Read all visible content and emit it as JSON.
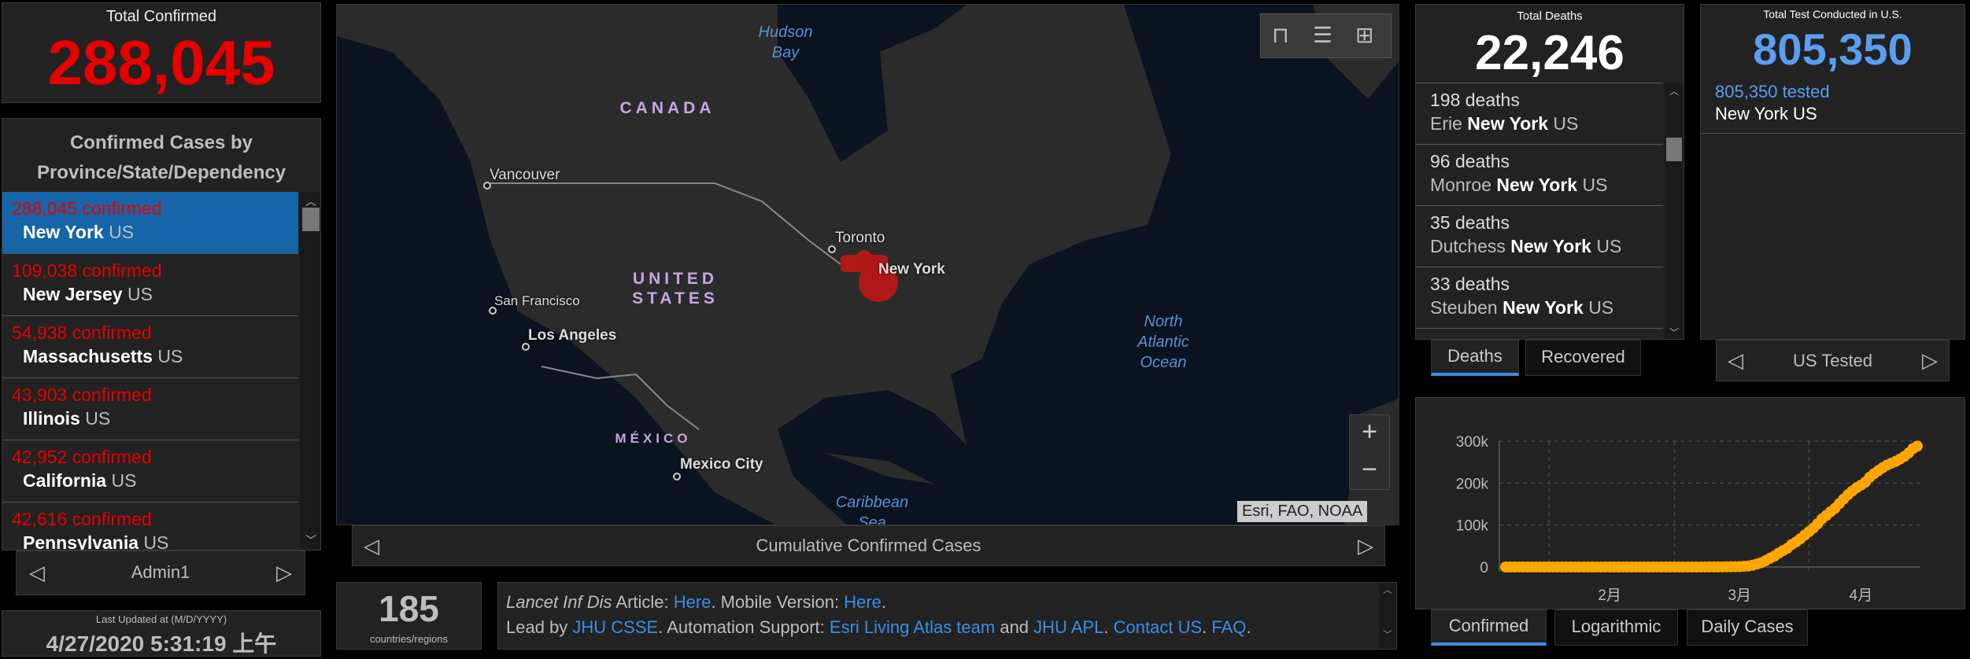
{
  "total_confirmed": {
    "title": "Total Confirmed",
    "value": "288,045"
  },
  "confirmed_list": {
    "title_line1": "Confirmed Cases by",
    "title_line2": "Province/State/Dependency",
    "items": [
      {
        "count": "288,045 confirmed",
        "region": "New York",
        "country": "US",
        "selected": true
      },
      {
        "count": "109,038 confirmed",
        "region": "New Jersey",
        "country": "US"
      },
      {
        "count": "54,938 confirmed",
        "region": "Massachusetts",
        "country": "US"
      },
      {
        "count": "43,903 confirmed",
        "region": "Illinois",
        "country": "US"
      },
      {
        "count": "42,952 confirmed",
        "region": "California",
        "country": "US"
      },
      {
        "count": "42,616 confirmed",
        "region": "Pennsylvania",
        "country": "US"
      }
    ],
    "footer_label": "Admin1"
  },
  "last_updated": {
    "label": "Last Updated at (M/D/YYYY)",
    "value": "4/27/2020 5:31:19 上午"
  },
  "map": {
    "labels": {
      "hudson1": "Hudson",
      "hudson2": "Bay",
      "canada": "CANADA",
      "vancouver": "Vancouver",
      "toronto": "Toronto",
      "new_york": "New York",
      "us1": "UNITED",
      "us2": "STATES",
      "san_francisco": "San Francisco",
      "los_angeles": "Los Angeles",
      "atl1": "North",
      "atl2": "Atlantic",
      "atl3": "Ocean",
      "mexico": "MÉXICO",
      "mexico_city": "Mexico City",
      "carib1": "Caribbean",
      "carib2": "Sea"
    },
    "attribution": "Esri, FAO, NOAA",
    "caption": "Cumulative Confirmed Cases",
    "zoom_in": "+",
    "zoom_out": "−",
    "toolbar_icons": [
      "bookmark-icon",
      "legend-list-icon",
      "basemap-gallery-icon"
    ],
    "colors": {
      "water": "#0b1320",
      "land": "#2b2b2b",
      "cases": "#c81414"
    }
  },
  "countries": {
    "value": "185",
    "label": "countries/regions"
  },
  "info": {
    "line1": [
      {
        "t": "Lancet Inf Dis",
        "style": "italic"
      },
      {
        "t": " Article: "
      },
      {
        "t": "Here",
        "link": true
      },
      {
        "t": ". Mobile Version: "
      },
      {
        "t": "Here",
        "link": true
      },
      {
        "t": "."
      }
    ],
    "line2": [
      {
        "t": "Lead by "
      },
      {
        "t": "JHU CSSE",
        "link": true
      },
      {
        "t": ". Automation Support: "
      },
      {
        "t": "Esri Living Atlas team",
        "link": true
      },
      {
        "t": " and "
      },
      {
        "t": "JHU APL",
        "link": true
      },
      {
        "t": ". "
      },
      {
        "t": "Contact US",
        "link": true
      },
      {
        "t": ". "
      },
      {
        "t": "FAQ",
        "link": true
      },
      {
        "t": "."
      }
    ]
  },
  "deaths": {
    "title": "Total Deaths",
    "value": "22,246",
    "items": [
      {
        "count": "198 deaths",
        "county": "Erie",
        "state": "New York",
        "country": "US"
      },
      {
        "count": "96 deaths",
        "county": "Monroe",
        "state": "New York",
        "country": "US"
      },
      {
        "count": "35 deaths",
        "county": "Dutchess",
        "state": "New York",
        "country": "US"
      },
      {
        "count": "33 deaths",
        "county": "Steuben",
        "state": "New York",
        "country": "US"
      }
    ],
    "tabs": [
      "Deaths",
      "Recovered"
    ]
  },
  "tests": {
    "title": "Total Test Conducted in U.S.",
    "value": "805,350",
    "item_count": "805,350 tested",
    "item_region": "New York US",
    "footer_label": "US Tested"
  },
  "chart_tabs": [
    "Confirmed",
    "Logarithmic",
    "Daily Cases"
  ],
  "chart_data": {
    "type": "scatter",
    "color": "#ffa500",
    "yticks": [
      "0",
      "100k",
      "200k",
      "300k"
    ],
    "ylim": [
      0,
      300000
    ],
    "xticks": [
      "2月",
      "3月",
      "4月"
    ],
    "grid": true,
    "x": [
      "1/22",
      "1/23",
      "1/24",
      "1/25",
      "1/26",
      "1/27",
      "1/28",
      "1/29",
      "1/30",
      "1/31",
      "2/1",
      "2/2",
      "2/3",
      "2/4",
      "2/5",
      "2/6",
      "2/7",
      "2/8",
      "2/9",
      "2/10",
      "2/11",
      "2/12",
      "2/13",
      "2/14",
      "2/15",
      "2/16",
      "2/17",
      "2/18",
      "2/19",
      "2/20",
      "2/21",
      "2/22",
      "2/23",
      "2/24",
      "2/25",
      "2/26",
      "2/27",
      "2/28",
      "2/29",
      "3/1",
      "3/2",
      "3/3",
      "3/4",
      "3/5",
      "3/6",
      "3/7",
      "3/8",
      "3/9",
      "3/10",
      "3/11",
      "3/12",
      "3/13",
      "3/14",
      "3/15",
      "3/16",
      "3/17",
      "3/18",
      "3/19",
      "3/20",
      "3/21",
      "3/22",
      "3/23",
      "3/24",
      "3/25",
      "3/26",
      "3/27",
      "3/28",
      "3/29",
      "3/30",
      "3/31",
      "4/1",
      "4/2",
      "4/3",
      "4/4",
      "4/5",
      "4/6",
      "4/7",
      "4/8",
      "4/9",
      "4/10",
      "4/11",
      "4/12",
      "4/13",
      "4/14",
      "4/15",
      "4/16",
      "4/17",
      "4/18",
      "4/19",
      "4/20",
      "4/21",
      "4/22",
      "4/23",
      "4/24",
      "4/25",
      "4/26"
    ],
    "values": [
      0,
      0,
      0,
      0,
      0,
      0,
      0,
      0,
      0,
      0,
      0,
      0,
      0,
      0,
      0,
      0,
      0,
      0,
      0,
      0,
      0,
      0,
      0,
      0,
      0,
      0,
      0,
      0,
      0,
      0,
      0,
      0,
      0,
      0,
      0,
      0,
      0,
      0,
      0,
      1,
      1,
      2,
      11,
      22,
      44,
      89,
      106,
      142,
      173,
      217,
      326,
      421,
      610,
      732,
      950,
      1700,
      2382,
      4152,
      7102,
      10356,
      15168,
      20875,
      25665,
      33066,
      38987,
      44635,
      53363,
      59568,
      67174,
      75832,
      83948,
      92506,
      102870,
      114775,
      122911,
      131815,
      139875,
      151061,
      161779,
      172348,
      181026,
      189033,
      195031,
      202208,
      213779,
      222284,
      229642,
      236732,
      242786,
      247512,
      251690,
      257216,
      263460,
      271590,
      282143,
      288045
    ]
  }
}
